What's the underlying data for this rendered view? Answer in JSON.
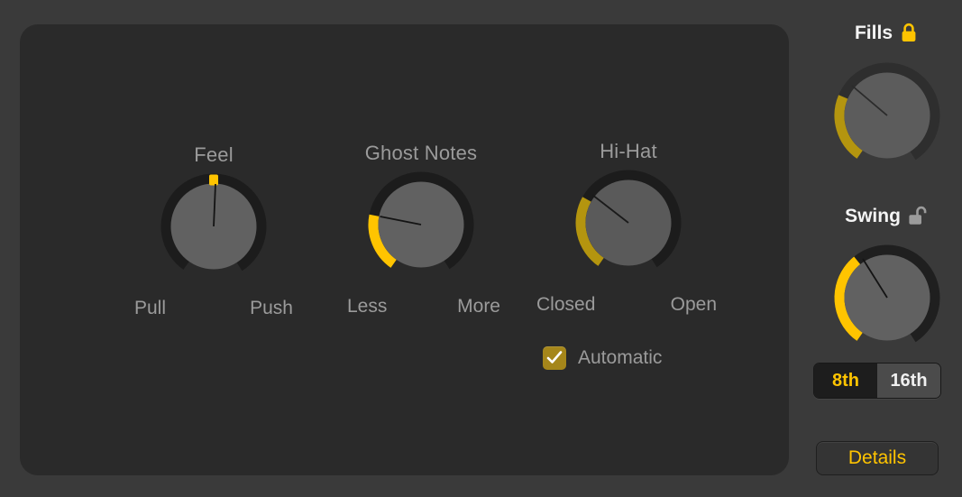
{
  "panel": {
    "knobs": [
      {
        "id": "feel",
        "title": "Feel",
        "left_label": "Pull",
        "right_label": "Push",
        "indicator": "center-tick",
        "arc_color": "#ffc400",
        "value_angle_deg": 0,
        "enabled": true
      },
      {
        "id": "ghost-notes",
        "title": "Ghost Notes",
        "left_label": "Less",
        "right_label": "More",
        "indicator": "arc",
        "arc_color": "#ffc400",
        "value_angle_deg": -101,
        "enabled": true
      },
      {
        "id": "hi-hat",
        "title": "Hi-Hat",
        "left_label": "Closed",
        "right_label": "Open",
        "indicator": "arc",
        "arc_color": "#b4950f",
        "value_angle_deg": -119,
        "enabled": false
      }
    ],
    "automatic": {
      "label": "Automatic",
      "checked": true,
      "check_icon": "checkmark-icon",
      "box_color": "#a5861a"
    }
  },
  "right_column": {
    "fills": {
      "label": "Fills",
      "lock_icon": "lock-closed-icon",
      "locked": true,
      "lock_color": "#ffc400",
      "arc_color": "#b4950f",
      "value_angle_deg": -125,
      "enabled": false
    },
    "swing": {
      "label": "Swing",
      "lock_icon": "lock-open-icon",
      "locked": false,
      "lock_color": "#9b9b9b",
      "arc_color": "#ffc400",
      "value_angle_deg": -144,
      "enabled": true
    },
    "resolution": {
      "options": [
        "8th",
        "16th"
      ],
      "selected": "8th"
    },
    "details_button": {
      "label": "Details",
      "color": "#ffc400"
    }
  },
  "colors": {
    "window_bg": "#3a3a3a",
    "panel_bg": "#2a2a2a",
    "knob_face": "#616161",
    "knob_track": "#1c1c1c",
    "accent": "#ffc400",
    "accent_dim": "#b4950f",
    "text_dim": "#9b9b9b",
    "text_bright": "#f2f2f2"
  }
}
